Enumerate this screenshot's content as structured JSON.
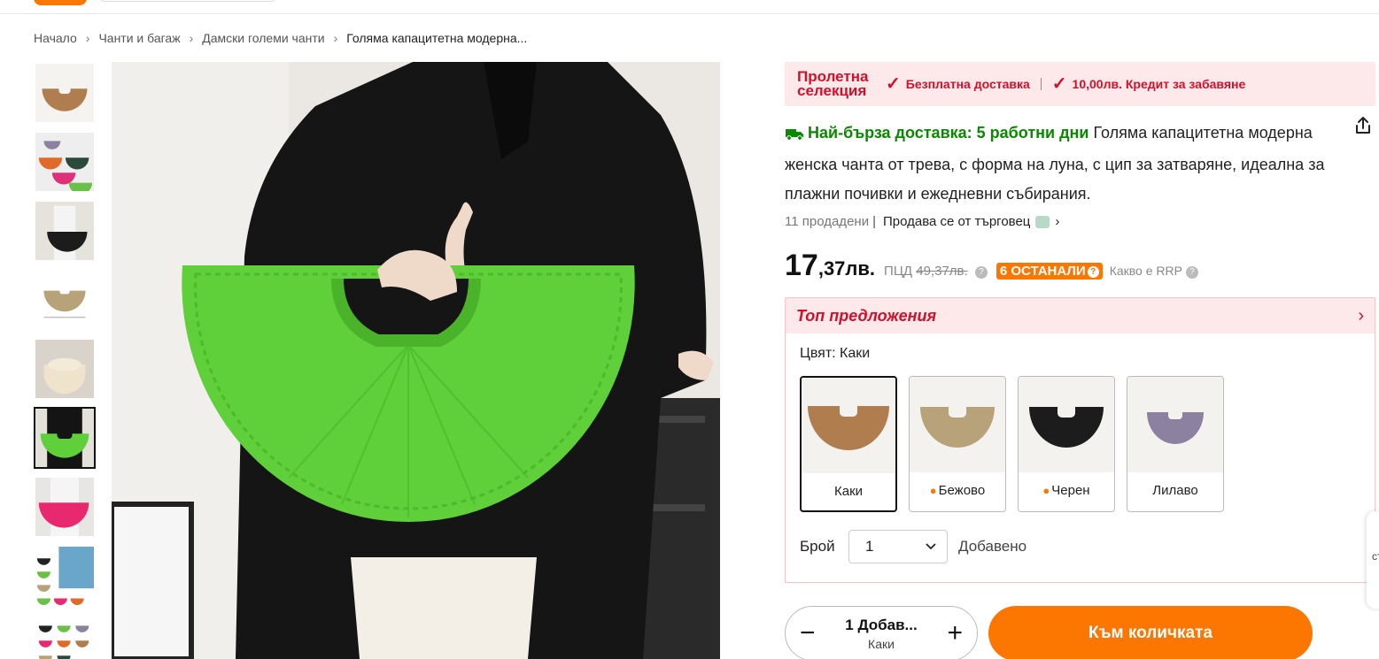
{
  "breadcrumb": {
    "items": [
      "Начало",
      "Чанти и багаж",
      "Дамски големи чанти",
      "Голяма капацитетна модерна..."
    ]
  },
  "promo": {
    "title": "Пролетна селекция",
    "items": [
      "Безплатна доставка",
      "10,00лв. Кредит за забавяне"
    ]
  },
  "product": {
    "delivery": "Най-бърза доставка: 5 работни дни",
    "title": "Голяма капацитетна модерна женска чанта от трева, с форма на луна, с цип за затваряне, идеална за плажни почивки и ежедневни събирания.",
    "sold": "11 продадени",
    "seller": "Продава се от търговец",
    "price_int": "17",
    "price_dec": ",37лв.",
    "rrp_label": "ПЦД",
    "rrp_value": "49,37лв.",
    "left_badge": "6 ОСТАНАЛИ",
    "rrp_link": "Какво е RRP"
  },
  "offers": {
    "title": "Топ предложения",
    "color_label": "Цвят: Каки",
    "swatches": [
      {
        "label": "Каки",
        "selected": true,
        "color": "#b07d4e",
        "flame": false
      },
      {
        "label": "Бежово",
        "selected": false,
        "color": "#b8a27a",
        "flame": true
      },
      {
        "label": "Черен",
        "selected": false,
        "color": "#1c1c1c",
        "flame": true
      },
      {
        "label": "Лилаво",
        "selected": false,
        "color": "#8c82a0",
        "flame": false
      }
    ],
    "qty_label": "Брой",
    "qty_value": "1",
    "qty_status": "Добавено"
  },
  "cart": {
    "stepper_qty": "1 Добав...",
    "stepper_color": "Каки",
    "button": "Към количката"
  },
  "edge_tab": "ст",
  "colors": {
    "accent": "#fb7701",
    "promo_red": "#d3102b",
    "delivery_green": "#0a8800",
    "bag_green": "#5fcf3a"
  }
}
